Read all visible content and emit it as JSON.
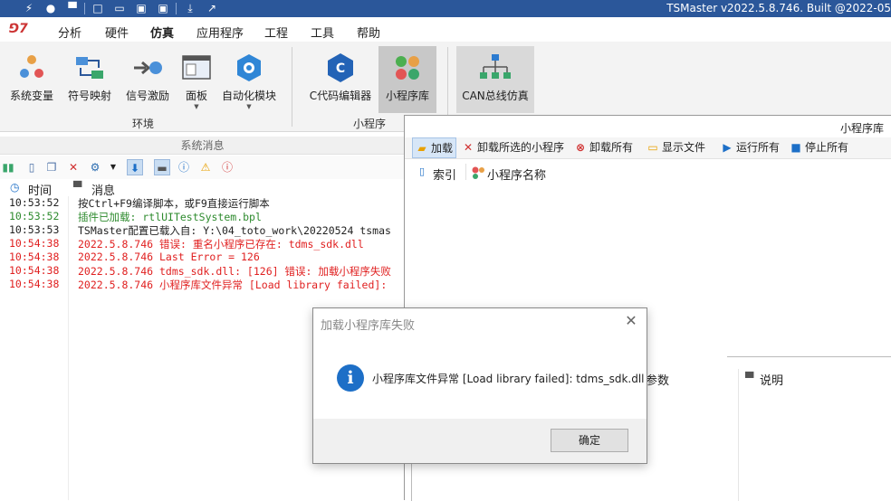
{
  "title_bar": {
    "app_title": "TSMaster v2022.5.8.746. Built @2022-05"
  },
  "menu": {
    "tabs": [
      "分析",
      "硬件",
      "仿真",
      "应用程序",
      "工程",
      "工具",
      "帮助"
    ],
    "active": "仿真"
  },
  "ribbon": {
    "env_buttons": [
      "系统变量",
      "符号映射",
      "信号激励",
      "面板",
      "自动化模块"
    ],
    "env_group": "环境",
    "applet_buttons": [
      "C代码编辑器",
      "小程序库"
    ],
    "applet_group": "小程序",
    "can_button": "CAN总线仿真"
  },
  "system_messages": {
    "header": "系统消息",
    "col_time": "时间",
    "col_msg": "消息",
    "rows": [
      {
        "time": "10:53:52",
        "msg": "按Ctrl+F9编译脚本，或F9直接运行脚本",
        "color": "#222222"
      },
      {
        "time": "10:53:52",
        "msg": "插件已加载: rtlUITestSystem.bpl",
        "color": "#2e8b2e"
      },
      {
        "time": "10:53:53",
        "msg": "TSMaster配置已载入自: Y:\\04_toto_work\\20220524 tsmas",
        "color": "#222222"
      },
      {
        "time": "10:54:38",
        "msg": "2022.5.8.746 错误: 重名小程序已存在: tdms_sdk.dll",
        "color": "#e02020"
      },
      {
        "time": "10:54:38",
        "msg": "2022.5.8.746 Last Error = 126",
        "color": "#e02020"
      },
      {
        "time": "10:54:38",
        "msg": "2022.5.8.746 tdms_sdk.dll: [126] 错误: 加载小程序失败",
        "color": "#e02020"
      },
      {
        "time": "10:54:38",
        "msg": "2022.5.8.746 小程序库文件异常 [Load library failed]:",
        "color": "#e02020"
      }
    ]
  },
  "applet_library": {
    "title": "小程序库",
    "toolbar": {
      "load": "加载",
      "unload_selected": "卸载所选的小程序",
      "unload_all": "卸载所有",
      "show_file": "显示文件",
      "run_all": "运行所有",
      "stop_all": "停止所有"
    },
    "col_index": "索引",
    "col_name": "小程序名称",
    "col_params": "参数",
    "col_desc": "说明"
  },
  "dialog": {
    "title": "加载小程序库失败",
    "message": "小程序库文件异常 [Load library failed]: tdms_sdk.dll",
    "ok": "确定"
  }
}
